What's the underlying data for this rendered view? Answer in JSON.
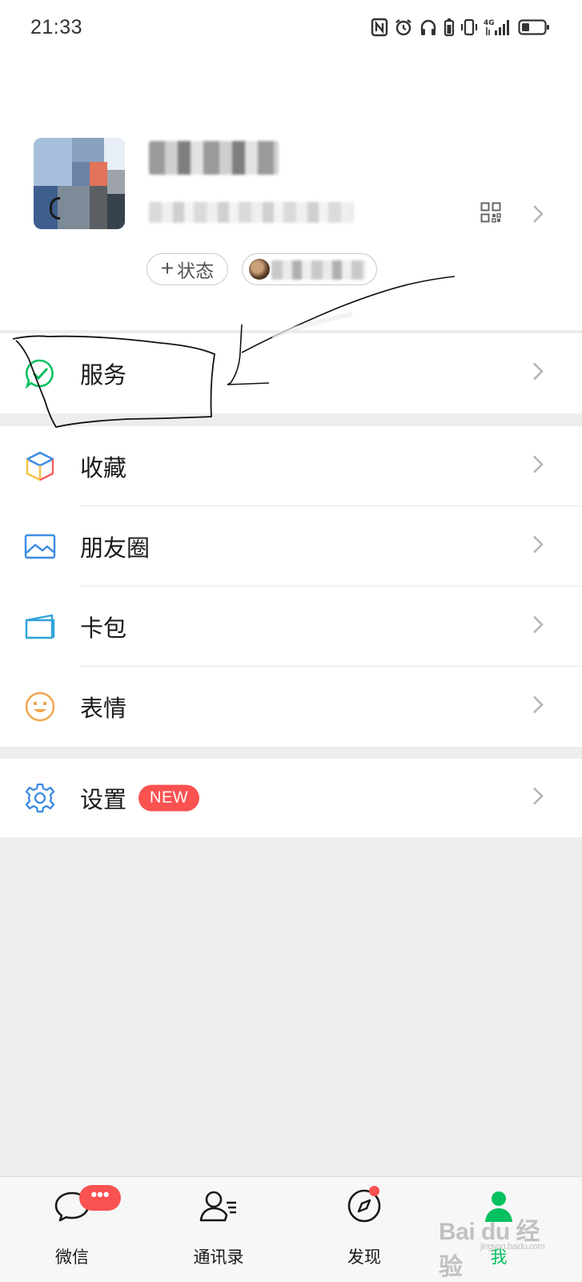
{
  "status_bar": {
    "time": "21:33",
    "icons": [
      "nfc-icon",
      "alarm-icon",
      "headphones-icon",
      "battery-saver-icon",
      "vibrate-icon",
      "signal-4g-icon",
      "battery-icon"
    ],
    "network_label": "4G"
  },
  "profile": {
    "add_status_plus": "+",
    "add_status_label": "状态"
  },
  "menu": {
    "services": {
      "label": "服务",
      "icon": "wechat-pay-icon",
      "color": "#07c160"
    },
    "favorites": {
      "label": "收藏",
      "icon": "cube-icon"
    },
    "moments": {
      "label": "朋友圈",
      "icon": "picture-icon",
      "color": "#3c8be3"
    },
    "cards": {
      "label": "卡包",
      "icon": "wallet-icon",
      "color": "#2fa3d8"
    },
    "stickers": {
      "label": "表情",
      "icon": "smiley-icon",
      "color": "#f0a44b"
    },
    "settings": {
      "label": "设置",
      "icon": "gear-icon",
      "color": "#3c8be3",
      "badge": "NEW"
    }
  },
  "tabbar": {
    "tabs": [
      {
        "label": "微信",
        "icon": "chat-bubble-icon",
        "badge": "•••"
      },
      {
        "label": "通讯录",
        "icon": "contacts-icon"
      },
      {
        "label": "发现",
        "icon": "compass-icon"
      },
      {
        "label": "我",
        "icon": "person-icon",
        "active": true
      }
    ]
  },
  "watermark": {
    "text": "Bai du 经验",
    "sub": "jingyan.baidu.com"
  },
  "colors": {
    "accent": "#07c160",
    "badge_red": "#fa5151",
    "background": "#ededed"
  }
}
